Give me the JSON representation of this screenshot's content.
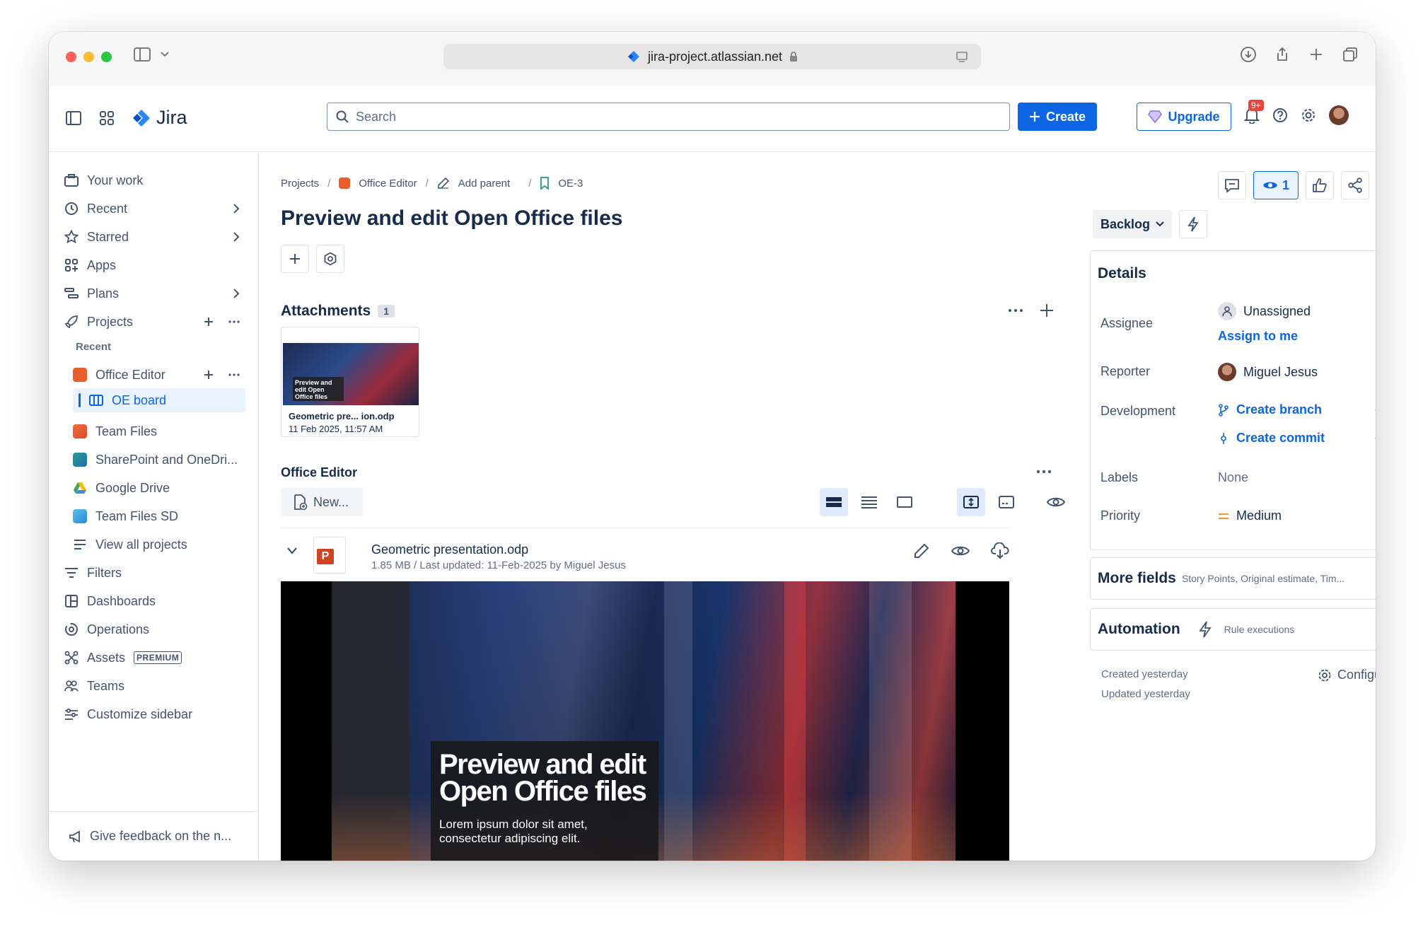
{
  "browser": {
    "url": "jira-project.atlassian.net",
    "traffic_colors": [
      "#ff5f57",
      "#febc2e",
      "#28c840"
    ]
  },
  "topbar": {
    "app_name": "Jira",
    "search_placeholder": "Search",
    "create_label": "Create",
    "upgrade_label": "Upgrade",
    "notifications_badge": "9+"
  },
  "sidebar": {
    "items": [
      {
        "label": "Your work"
      },
      {
        "label": "Recent"
      },
      {
        "label": "Starred"
      },
      {
        "label": "Apps"
      },
      {
        "label": "Plans"
      },
      {
        "label": "Projects"
      }
    ],
    "recent_label": "Recent",
    "projects": [
      {
        "label": "Office Editor"
      },
      {
        "label": "OE board"
      },
      {
        "label": "Team Files"
      },
      {
        "label": "SharePoint and OneDri..."
      },
      {
        "label": "Google Drive"
      },
      {
        "label": "Team Files SD"
      },
      {
        "label": "View all projects"
      }
    ],
    "bottom_items": [
      {
        "label": "Filters"
      },
      {
        "label": "Dashboards"
      },
      {
        "label": "Operations"
      },
      {
        "label": "Assets"
      },
      {
        "label": "Teams"
      },
      {
        "label": "Customize sidebar"
      }
    ],
    "premium_badge": "PREMIUM",
    "feedback": "Give feedback on the n..."
  },
  "breadcrumb": {
    "projects": "Projects",
    "project": "Office Editor",
    "add_parent": "Add parent",
    "issue_key": "OE-3"
  },
  "issue": {
    "title": "Preview and edit Open Office files"
  },
  "attachments": {
    "heading": "Attachments",
    "count": "1",
    "thumb_title": "Preview and edit Open Office files",
    "file_name": "Geometric pre... ion.odp",
    "file_date": "11 Feb 2025, 11:57 AM"
  },
  "office_editor": {
    "heading": "Office Editor",
    "new_label": "New...",
    "file_name": "Geometric presentation.odp",
    "file_meta": "1.85 MB / Last updated: 11-Feb-2025 by Miguel Jesus",
    "slide_title": "Preview and edit Open Office files",
    "slide_subtitle": "Lorem ipsum dolor sit amet, consectetur adipiscing elit."
  },
  "actions": {
    "watch_count": "1"
  },
  "status": {
    "label": "Backlog"
  },
  "details": {
    "heading": "Details",
    "assignee_label": "Assignee",
    "assignee_value": "Unassigned",
    "assign_to_me": "Assign to me",
    "reporter_label": "Reporter",
    "reporter_value": "Miguel Jesus",
    "development_label": "Development",
    "create_branch": "Create branch",
    "create_commit": "Create commit",
    "labels_label": "Labels",
    "labels_value": "None",
    "priority_label": "Priority",
    "priority_value": "Medium"
  },
  "more_fields": {
    "heading": "More fields",
    "summary": "Story Points, Original estimate, Tim..."
  },
  "automation": {
    "heading": "Automation",
    "summary": "Rule executions"
  },
  "meta": {
    "created": "Created yesterday",
    "updated": "Updated yesterday",
    "configure": "Configure"
  }
}
